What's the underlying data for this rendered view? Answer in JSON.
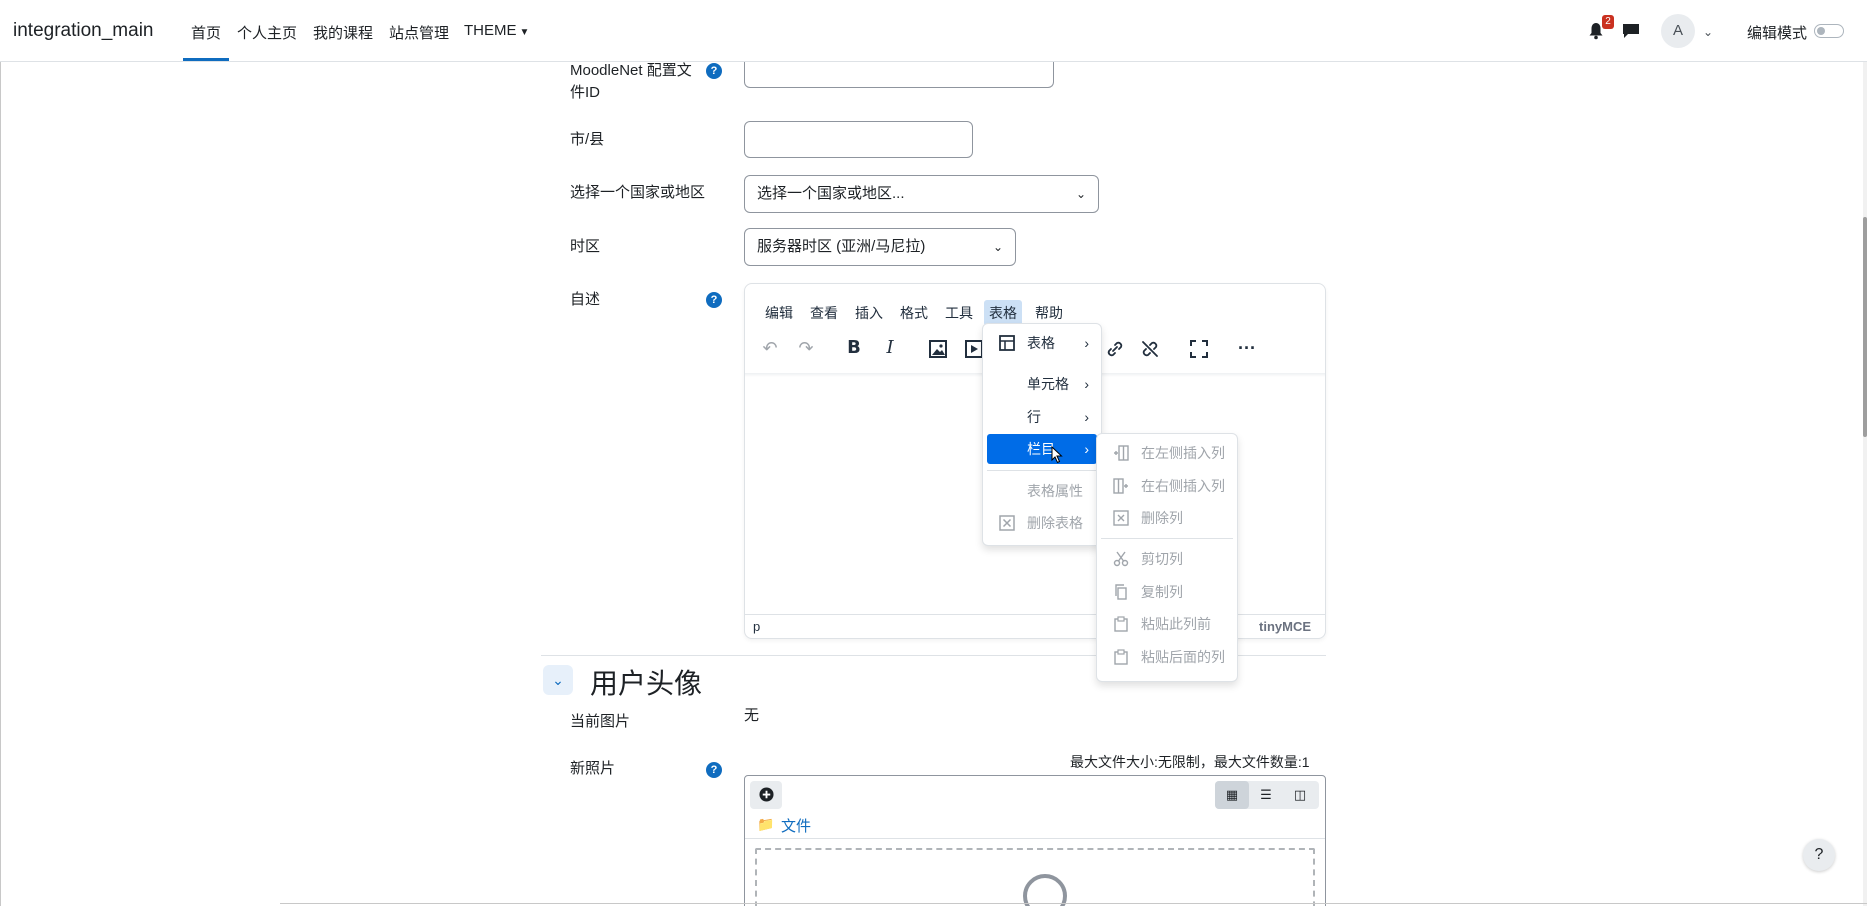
{
  "navbar": {
    "brand": "integration_main",
    "items": [
      "首页",
      "个人主页",
      "我的课程",
      "站点管理",
      "THEME"
    ],
    "notification_count": "2",
    "avatar_initial": "A",
    "edit_mode_label": "编辑模式"
  },
  "form": {
    "moodlenet_label_line1": "MoodleNet 配置文",
    "moodlenet_label_line2": "件ID",
    "city_label": "市/县",
    "country_label": "选择一个国家或地区",
    "country_value": "选择一个国家或地区...",
    "timezone_label": "时区",
    "timezone_value": "服务器时区 (亚洲/马尼拉)",
    "description_label": "自述",
    "help_glyph": "?"
  },
  "editor": {
    "menubar": [
      "编辑",
      "查看",
      "插入",
      "格式",
      "工具",
      "表格",
      "帮助"
    ],
    "status_path": "p",
    "brand": "tinyMCE"
  },
  "table_menu": {
    "items": [
      {
        "label": "表格",
        "submenu": true
      },
      {
        "label": "单元格",
        "submenu": true
      },
      {
        "label": "行",
        "submenu": true
      },
      {
        "label": "栏目",
        "submenu": true
      },
      {
        "label": "表格属性",
        "submenu": false
      },
      {
        "label": "删除表格",
        "submenu": false
      }
    ]
  },
  "column_menu": {
    "items": [
      "在左侧插入列",
      "在右侧插入列",
      "删除列",
      "剪切列",
      "复制列",
      "粘贴此列前",
      "粘贴后面的列"
    ]
  },
  "avatar_section": {
    "title": "用户头像",
    "current_picture_label": "当前图片",
    "current_picture_value": "无",
    "new_picture_label": "新照片",
    "file_limits": "最大文件大小:无限制，最大文件数量:1",
    "folder_label": "文件"
  },
  "colors": {
    "primary": "#0f6cbf",
    "menu_highlight": "#006ce7",
    "badge": "#ca3120"
  }
}
